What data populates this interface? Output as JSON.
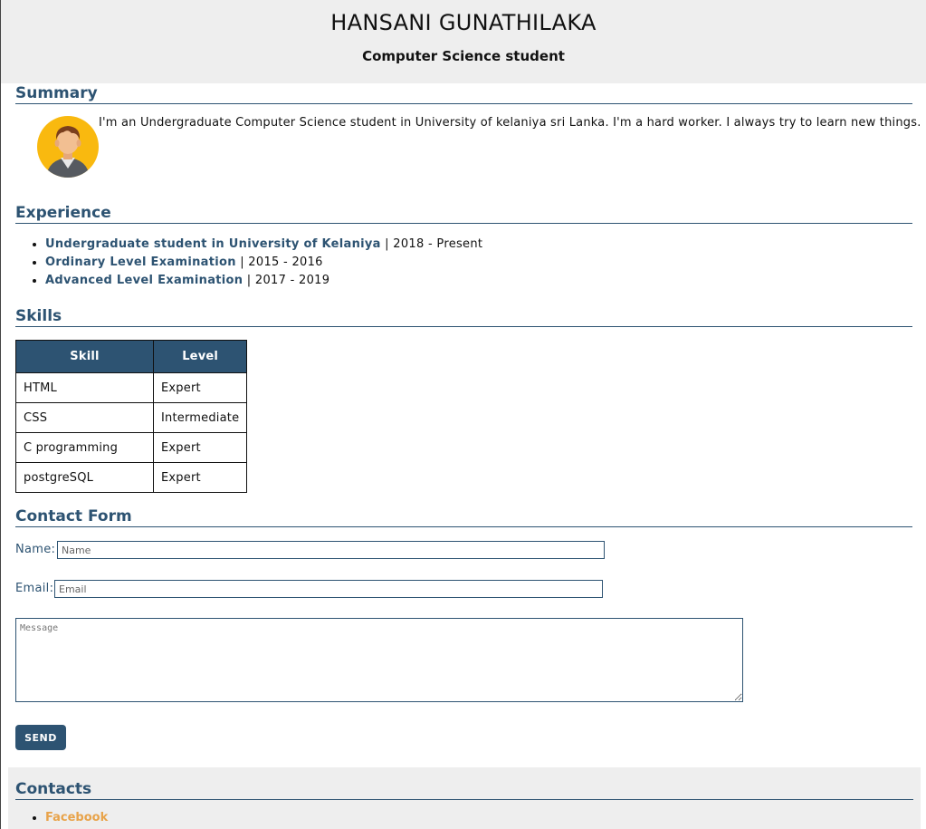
{
  "header": {
    "name": "HANSANI GUNATHILAKA",
    "subtitle": "Computer Science student"
  },
  "summary": {
    "title": "Summary",
    "text": "I'm an Undergraduate Computer Science student in University of kelaniya sri Lanka. I'm a hard worker. I always try to learn new things.",
    "avatar_icon": "user-avatar-icon"
  },
  "experience": {
    "title": "Experience",
    "items": [
      {
        "title": "Undergraduate student in University of Kelaniya",
        "period": " | 2018 - Present"
      },
      {
        "title": "Ordinary Level Examination",
        "period": " | 2015 - 2016"
      },
      {
        "title": "Advanced Level Examination",
        "period": " | 2017 - 2019"
      }
    ]
  },
  "skills": {
    "title": "Skills",
    "headers": [
      "Skill",
      "Level"
    ],
    "rows": [
      [
        "HTML",
        "Expert"
      ],
      [
        "CSS",
        "Intermediate"
      ],
      [
        "C programming",
        "Expert"
      ],
      [
        "postgreSQL",
        "Expert"
      ]
    ]
  },
  "contact_form": {
    "title": "Contact Form",
    "name_label": "Name:",
    "name_placeholder": "Name",
    "email_label": "Email:",
    "email_placeholder": "Email",
    "message_placeholder": "Message",
    "send_label": "SEND"
  },
  "contacts": {
    "title": "Contacts",
    "links": [
      "Facebook"
    ]
  },
  "colors": {
    "accent": "#2d5372",
    "link": "#e8a34a",
    "header_bg": "#eeeeee"
  }
}
